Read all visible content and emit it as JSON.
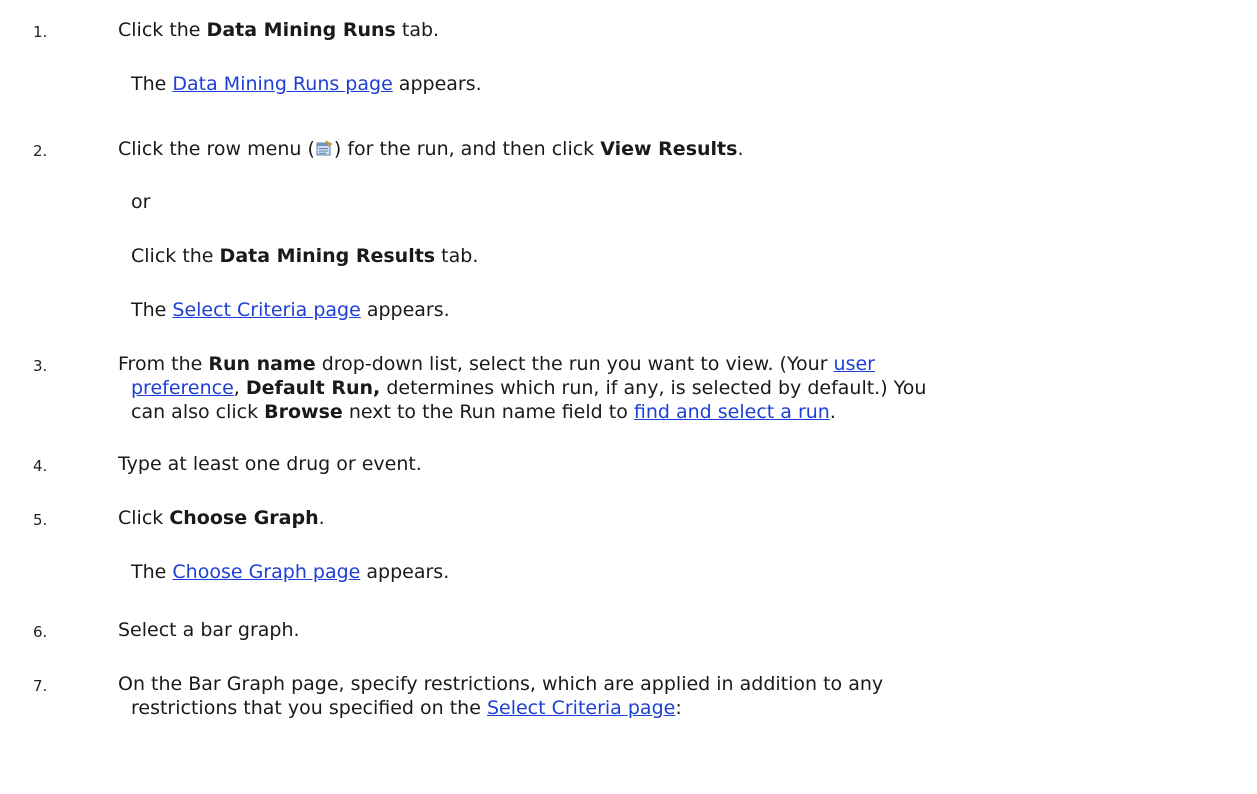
{
  "steps": [
    {
      "number": "1.",
      "parts": [
        "Click the ",
        "Data Mining Runs",
        " tab."
      ],
      "result": {
        "pre": "The ",
        "link": "Data Mining Runs page",
        "post": " appears."
      }
    },
    {
      "number": "2.",
      "parts": [
        "Click the row menu (",
        ") for the run, and then click ",
        "View Results",
        "."
      ],
      "icon": "row-menu-icon",
      "or_text": "or",
      "alt": [
        "Click the ",
        "Data Mining Results",
        " tab."
      ],
      "result": {
        "pre": "The ",
        "link": "Select Criteria page",
        "post": " appears."
      }
    },
    {
      "number": "3.",
      "line1": {
        "a": "From the ",
        "b": "Run name",
        "c": " drop-down list, select the run you want to view. (Your ",
        "link": "user"
      },
      "line2": {
        "link": "preference",
        "a": ", ",
        "b": "Default Run,",
        "c": " determines which run, if any, is selected by default.) You"
      },
      "line3": {
        "a": "can also click ",
        "b": "Browse",
        "c": " next to the Run name field to ",
        "link": "find and select a run",
        "d": "."
      }
    },
    {
      "number": "4.",
      "text": "Type at least one drug or event."
    },
    {
      "number": "5.",
      "parts": [
        "Click ",
        "Choose Graph",
        "."
      ],
      "result": {
        "pre": "The ",
        "link": "Choose Graph page",
        "post": " appears."
      }
    },
    {
      "number": "6.",
      "text": "Select a bar graph."
    },
    {
      "number": "7.",
      "line1": "On the Bar Graph page, specify restrictions, which are applied in addition to any",
      "line2": {
        "a": "restrictions that you specified on the ",
        "link": "Select Criteria page",
        "b": ":"
      }
    }
  ],
  "colors": {
    "link": "#1d3fd4",
    "text": "#1a1a1a"
  }
}
